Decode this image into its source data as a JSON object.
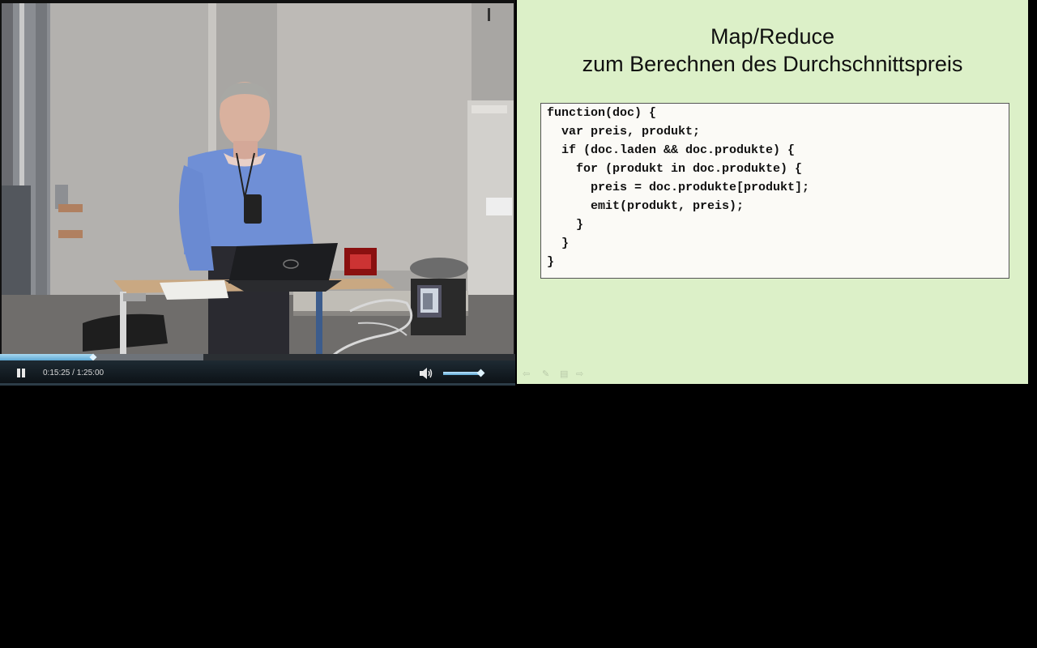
{
  "player": {
    "current_time": "0:15:25",
    "duration": "1:25:00",
    "time_separator": " / ",
    "progress_fraction": 0.181,
    "buffered_fraction": 0.394,
    "volume_fraction": 0.9,
    "state": "playing",
    "accent_color": "#5fa9d4"
  },
  "slide": {
    "title_line1": "Map/Reduce",
    "title_line2": "zum Berechnen des Durchschnittspreis",
    "code_lines": [
      "function(doc) {",
      "  var preis, produkt;",
      "  if (doc.laden && doc.produkte) {",
      "    for (produkt in doc.produkte) {",
      "      preis = doc.produkte[produkt];",
      "      emit(produkt, preis);",
      "    }",
      "  }",
      "}"
    ],
    "background_color": "#dcf0c8",
    "nav_icons": [
      "arrow-left-icon",
      "pen-icon",
      "screen-icon",
      "arrow-right-icon"
    ]
  }
}
